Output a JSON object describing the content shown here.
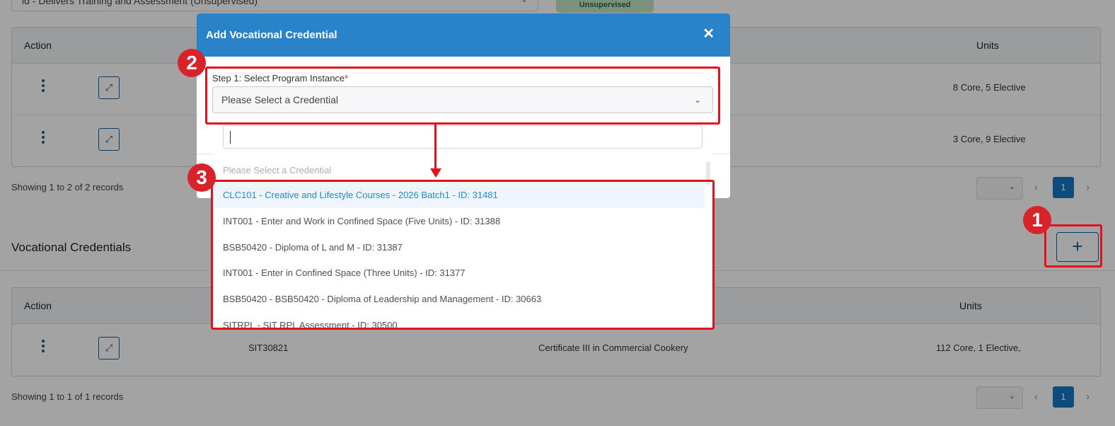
{
  "background": {
    "top_select_value": "ld - Delivers Training and Assessment (Unsupervised)",
    "top_badge": "Unsupervised",
    "table1": {
      "headers": {
        "action": "Action",
        "units": "Units"
      },
      "rows": [
        {
          "units": "8 Core, 5 Elective"
        },
        {
          "units": "3 Core, 9 Elective"
        }
      ],
      "records_text": "Showing 1 to 2 of 2 records",
      "page": "1"
    },
    "section_title": "Vocational Credentials",
    "add_button": "+",
    "table2": {
      "headers": {
        "action": "Action",
        "units": "Units"
      },
      "rows": [
        {
          "code": "SIT30821",
          "name": "Certificate III in Commercial Cookery",
          "units": "112 Core, 1 Elective,"
        }
      ],
      "records_text": "Showing 1 to 1 of 1 records",
      "page": "1"
    }
  },
  "modal": {
    "title": "Add Vocational Credential",
    "close": "✕",
    "step_label": "Step 1: Select Program Instance",
    "required_mark": "*",
    "select_value": "Please Select a Credential",
    "dropdown": {
      "search_value": "",
      "placeholder_option": "Please Select a Credential",
      "options": [
        "CLC101 - Creative and Lifestyle Courses - 2026 Batch1 - ID: 31481",
        "INT001 - Enter and Work in Confined Space (Five Units) - ID: 31388",
        "BSB50420 - Diploma of L and M - ID: 31387",
        "INT001 - Enter in Confined Space (Three Units) - ID: 31377",
        "BSB50420 - BSB50420 - Diploma of Leadership and Management - ID: 30663",
        "SITRPL - SIT RPL Assessment - ID: 30500"
      ],
      "highlighted_index": 0
    }
  },
  "annotations": {
    "n1": "1",
    "n2": "2",
    "n3": "3"
  },
  "colors": {
    "primary": "#2a82c8",
    "annotation_red": "#e3111b",
    "highlight_text": "#1a8fd6"
  }
}
